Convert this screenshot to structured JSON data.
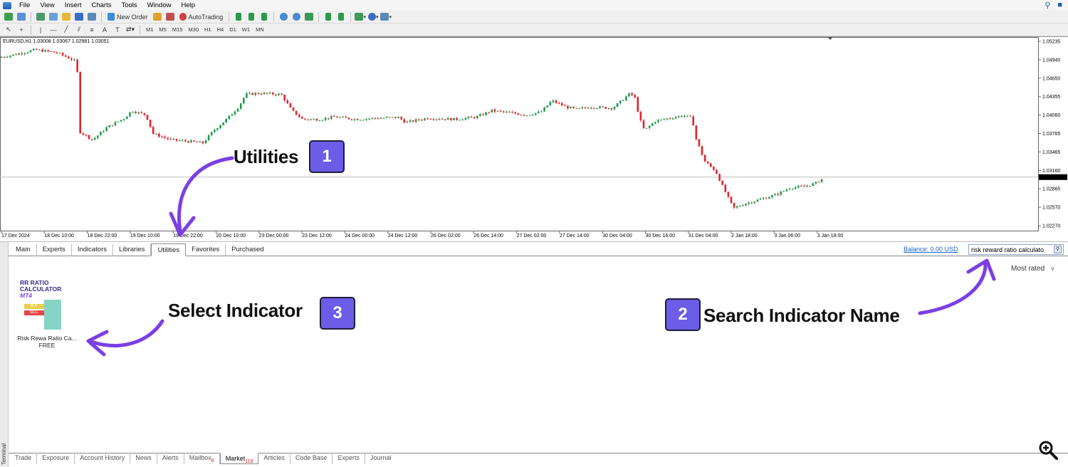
{
  "menu": [
    "File",
    "View",
    "Insert",
    "Charts",
    "Tools",
    "Window",
    "Help"
  ],
  "toolbar": {
    "new_order": "New Order",
    "autotrading": "AutoTrading",
    "timeframes": [
      "M1",
      "M5",
      "M15",
      "M30",
      "H1",
      "H4",
      "D1",
      "W1",
      "MN"
    ]
  },
  "chart": {
    "title": "EURUSD,H1  1.03008 1.03067 1.02981 1.03051",
    "price_labels": [
      "1.05235",
      "1.04940",
      "1.04650",
      "1.04355",
      "1.04060",
      "1.03765",
      "1.03465",
      "1.03160",
      "1.02865",
      "1.02570",
      "1.02270"
    ],
    "current_price": "1.03051",
    "time_labels": [
      "17 Dec 2024",
      "18 Dec 10:00",
      "18 Dec 22:00",
      "19 Dec 10:00",
      "19 Dec 22:00",
      "20 Dec 10:00",
      "23 Dec 00:00",
      "23 Dec 12:00",
      "24 Dec 00:00",
      "24 Dec 12:00",
      "26 Dec 02:00",
      "26 Dec 14:00",
      "27 Dec 02:00",
      "27 Dec 14:00",
      "30 Dec 04:00",
      "30 Dec 16:00",
      "31 Dec 04:00",
      "2 Jan 18:00",
      "3 Jan 06:00",
      "3 Jan 18:00"
    ]
  },
  "market": {
    "tabs": [
      "Main",
      "Experts",
      "Indicators",
      "Libraries",
      "Utilities",
      "Favorites",
      "Purchased"
    ],
    "active_tab": "Utilities",
    "balance": "Balance: 0.00 USD",
    "search_value": "risk reward ratio calculato",
    "sort": "Most rated",
    "product": {
      "logo_line1": "RR RATIO",
      "logo_line2": "CALCULATOR",
      "logo_line3": "MT4",
      "buy": "BUY",
      "sell": "SELL",
      "name": "Risk Rewa Ratio Ca...",
      "price": "FREE"
    }
  },
  "terminal": {
    "side_label": "Terminal",
    "tabs": [
      {
        "label": "Trade",
        "badge": ""
      },
      {
        "label": "Exposure",
        "badge": ""
      },
      {
        "label": "Account History",
        "badge": ""
      },
      {
        "label": "News",
        "badge": ""
      },
      {
        "label": "Alerts",
        "badge": ""
      },
      {
        "label": "Mailbox",
        "badge": "8"
      },
      {
        "label": "Market",
        "badge": "118"
      },
      {
        "label": "Articles",
        "badge": ""
      },
      {
        "label": "Code Base",
        "badge": ""
      },
      {
        "label": "Experts",
        "badge": ""
      },
      {
        "label": "Journal",
        "badge": ""
      }
    ],
    "active_tab": "Market"
  },
  "annotations": {
    "step1": {
      "label": "Utilities",
      "num": "1"
    },
    "step2": {
      "label": "Search Indicator Name",
      "num": "2"
    },
    "step3": {
      "label": "Select Indicator",
      "num": "3"
    }
  },
  "colors": {
    "bull": "#1e9a4a",
    "bear": "#e0242a",
    "annotation": "#6c5ce7",
    "arrow": "#7b3fe4"
  }
}
